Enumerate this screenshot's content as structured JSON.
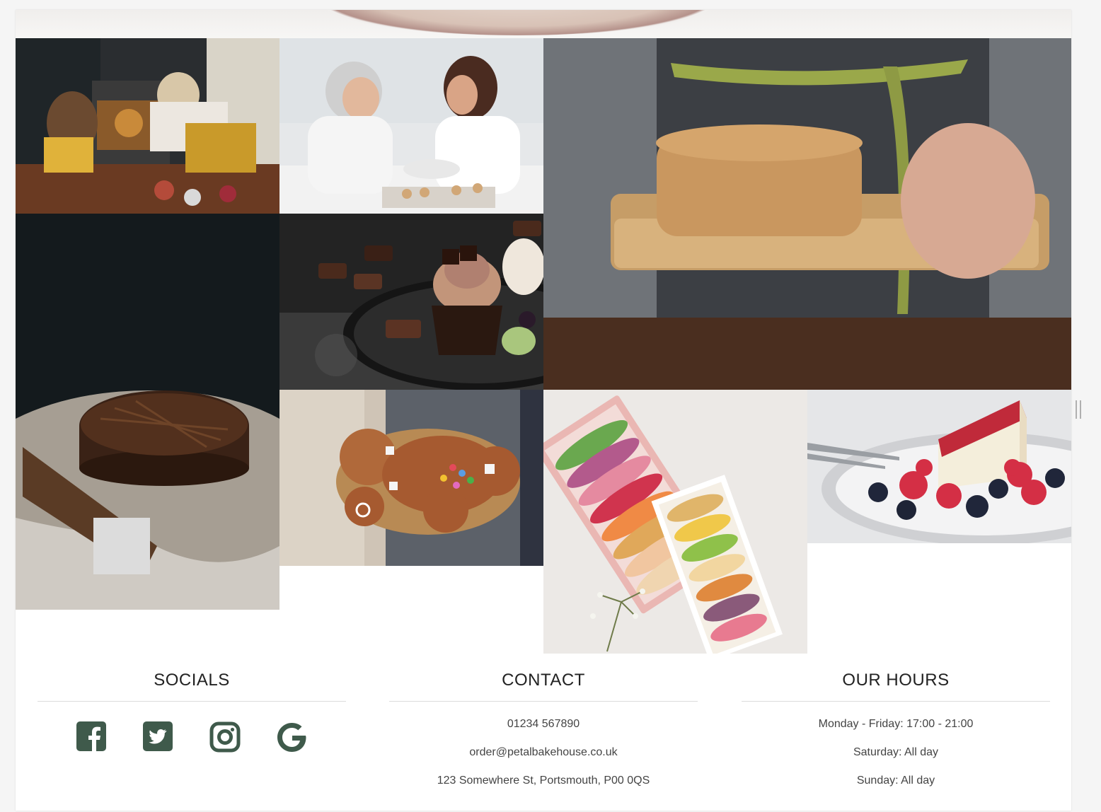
{
  "colors": {
    "accent": "#3f5a4b",
    "heading": "#222222",
    "text": "#444444",
    "divider": "#dcdcdc",
    "background": "#ffffff"
  },
  "gallery": {
    "images": [
      {
        "name": "photo-baking-at-oven"
      },
      {
        "name": "photo-kitchen-conversation"
      },
      {
        "name": "photo-sponge-cake-on-board"
      },
      {
        "name": "photo-chocolate-cake"
      },
      {
        "name": "photo-chocolate-cupcake"
      },
      {
        "name": "photo-gingerbread-man"
      },
      {
        "name": "photo-macarons-boxes"
      },
      {
        "name": "photo-cheesecake-berries"
      }
    ]
  },
  "footer": {
    "socials": {
      "title": "SOCIALS",
      "icons": [
        "facebook-icon",
        "twitter-icon",
        "instagram-icon",
        "google-icon"
      ]
    },
    "contact": {
      "title": "CONTACT",
      "phone": "01234 567890",
      "email": "order@petalbakehouse.co.uk",
      "address": "123 Somewhere St, Portsmouth, P00 0QS"
    },
    "hours": {
      "title": "OUR HOURS",
      "weekdays": "Monday - Friday: 17:00 - 21:00",
      "saturday": "Saturday: All day",
      "sunday": "Sunday: All day"
    }
  }
}
